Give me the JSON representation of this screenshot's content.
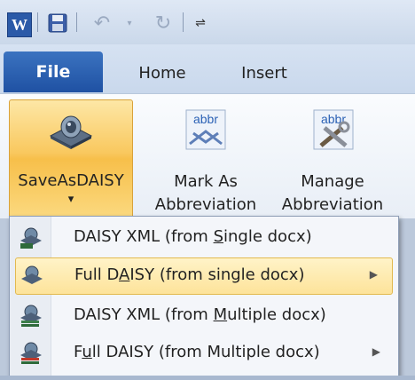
{
  "quick_access": {
    "app_icon_letter": "W",
    "customize_glyph": "⇌"
  },
  "tabs": {
    "file": "File",
    "home": "Home",
    "insert": "Insert"
  },
  "ribbon": {
    "save_as_daisy": {
      "label": "SaveAsDAISY",
      "dropdown": "▾"
    },
    "mark_as_abbreviation": {
      "line1": "Mark As",
      "line2": "Abbreviation",
      "icon_text": "abbr"
    },
    "manage_abbreviation": {
      "line1": "Manage",
      "line2": "Abbreviation",
      "icon_text": "abbr"
    }
  },
  "menu": {
    "items": [
      {
        "pre": "DAISY XML (from ",
        "ul": "S",
        "post": "ingle docx)",
        "submenu": false,
        "icon": "daisy-xml-icon"
      },
      {
        "pre": "Full D",
        "ul": "A",
        "post": "ISY (from single docx)",
        "submenu": true,
        "icon": "daisy-full-icon"
      },
      {
        "pre": "DAISY XML (from ",
        "ul": "M",
        "post": "ultiple docx)",
        "submenu": false,
        "icon": "daisy-xml-multi-icon"
      },
      {
        "pre": "F",
        "ul": "u",
        "post": "ll DAISY (from Multiple docx)",
        "submenu": true,
        "icon": "daisy-full-multi-icon"
      }
    ],
    "highlighted_index": 1,
    "submenu_arrow": "▶"
  },
  "colors": {
    "file_tab": "#2a60b0",
    "highlight": "#fde39a",
    "button_hover": "#f9c85e"
  }
}
